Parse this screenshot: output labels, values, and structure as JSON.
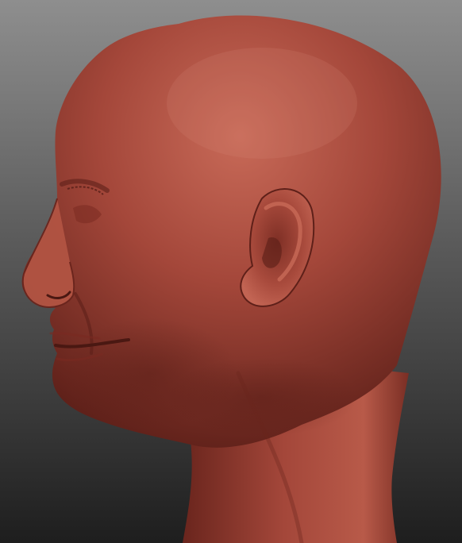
{
  "scene": {
    "subject": "sculpted-head-profile",
    "colors": {
      "background_top": "#8e8e8e",
      "background_bottom": "#1e1e1e",
      "clay_base": "#a4473a",
      "clay_highlight": "#c86a58",
      "clay_shadow": "#5e2019"
    }
  }
}
